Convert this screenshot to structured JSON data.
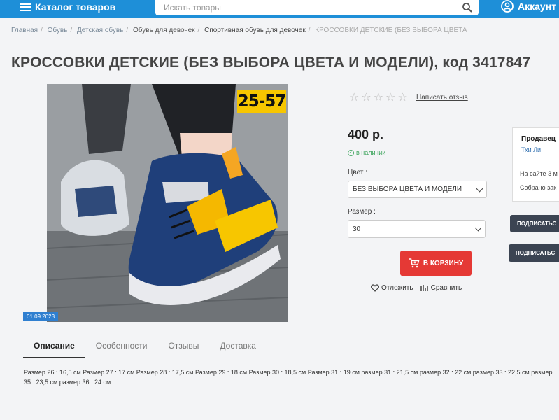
{
  "header": {
    "catalog_label": "Каталог товаров",
    "search_placeholder": "Искать товары",
    "account_label": "Аккаунт"
  },
  "breadcrumb": [
    "Главная",
    "Обувь",
    "Детская обувь",
    "Обувь для девочек",
    "Спортивная обувь для девочек",
    "КРОССОВКИ ДЕТСКИЕ (БЕЗ ВЫБОРА ЦВЕТА"
  ],
  "product": {
    "title": "КРОССОВКИ ДЕТСКИЕ (БЕЗ ВЫБОРА ЦВЕТА И МОДЕЛИ), код 3417847",
    "size_badge": "25-57",
    "date_badge": "01.09.2023",
    "rating_stars": 5,
    "review_link": "Написать отзыв",
    "price": "400 р.",
    "stock": "в наличии",
    "color_label": "Цвет :",
    "color_value": "БЕЗ ВЫБОРА ЦВЕТА И МОДЕЛИ",
    "size_label": "Размер :",
    "size_value": "30",
    "cart_button": "В КОРЗИНУ",
    "defer_label": "Отложить",
    "compare_label": "Сравнить"
  },
  "seller": {
    "title": "Продавец",
    "name": "Тхи Ли",
    "line1": "На сайте 3 м",
    "line2": "Собрано зак",
    "subscribe1": "ПОДПИСАТЬС",
    "subscribe2": "ПОДПИСАТЬС"
  },
  "tabs": [
    "Описание",
    "Особенности",
    "Отзывы",
    "Доставка"
  ],
  "description": "Размер 26 : 16,5 см Размер 27 : 17 см Размер 28 : 17,5 см Размер 29 : 18 см Размер 30 : 18,5 см Размер 31 : 19 см размер 31 : 21,5 см размер 32 : 22 см размер 33 : 22,5 см размер 35 : 23,5 см размер 36 : 24 см",
  "colors": {
    "brand_blue": "#1e8fd8",
    "cart_red": "#e53935",
    "badge_yellow": "#f7c600",
    "stock_green": "#3aa35a"
  }
}
